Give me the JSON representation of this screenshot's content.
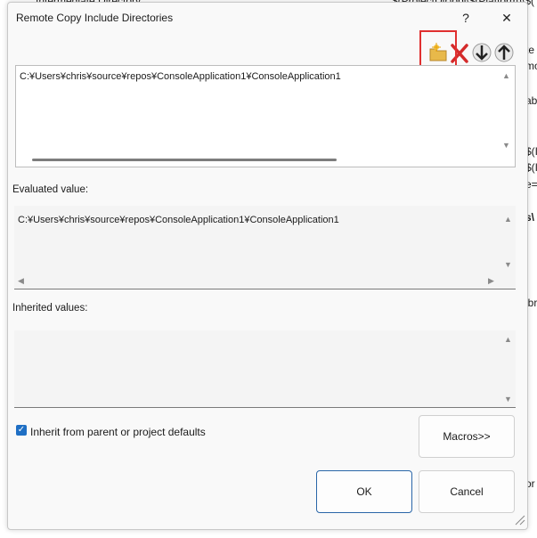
{
  "background": {
    "top_snippet": "Intermediate Directory",
    "top_right_snippet": "$(ProjectDir)obj\\$(Platform)\\$(",
    "right_fragments": [
      "te",
      "mo",
      "ab",
      "$(I",
      "$(I",
      "e=a",
      "s\\",
      "ibr",
      "or"
    ]
  },
  "dialog": {
    "title": "Remote Copy Include Directories",
    "help_glyph": "?",
    "close_glyph": "✕",
    "editor_value": "C:¥Users¥chris¥source¥repos¥ConsoleApplication1¥ConsoleApplication1",
    "evaluated_label": "Evaluated value:",
    "evaluated_value": "C:¥Users¥chris¥source¥repos¥ConsoleApplication1¥ConsoleApplication1",
    "inherited_label": "Inherited values:",
    "inherit_checkbox_label": "Inherit from parent or project defaults",
    "inherit_checked": true,
    "macros_button": "Macros>>",
    "ok_button": "OK",
    "cancel_button": "Cancel"
  },
  "icons": {
    "new_line": "folder-new-icon",
    "delete": "delete-icon",
    "move_down": "arrow-down-icon",
    "move_up": "arrow-up-icon"
  },
  "colors": {
    "accent": "#1f6fc4",
    "highlight": "#e03030"
  }
}
